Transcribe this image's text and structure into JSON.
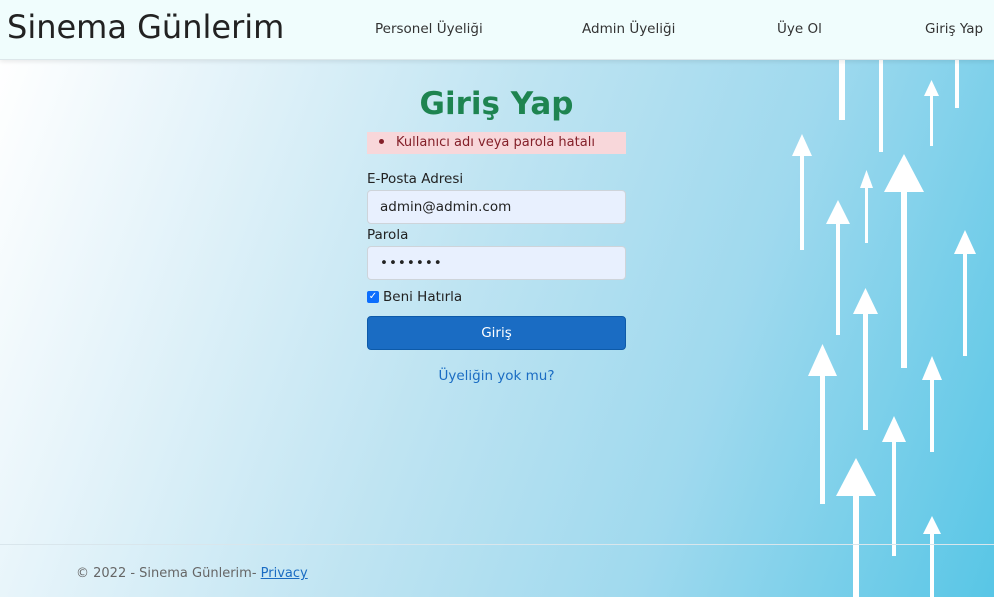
{
  "brand": "Sinema Günlerim",
  "nav": [
    {
      "label": "Personel Üyeliği"
    },
    {
      "label": "Admin Üyeliği"
    },
    {
      "label": "Üye Ol"
    },
    {
      "label": "Giriş Yap"
    }
  ],
  "login": {
    "title": "Giriş Yap",
    "error": "Kullanıcı adı veya parola hatalı",
    "email_label": "E-Posta Adresi",
    "email_value": "admin@admin.com",
    "password_label": "Parola",
    "password_value": "•••••••",
    "remember_label": "Beni Hatırla",
    "remember_checked": true,
    "submit_label": "Giriş",
    "signup_link": "Üyeliğin yok mu?"
  },
  "footer": {
    "text": "© 2022 - Sinema Günlerim- ",
    "privacy_link": "Privacy"
  },
  "colors": {
    "title": "#1e8450",
    "button": "#1a6cc3",
    "alert_bg": "#f8d7da",
    "alert_text": "#842029"
  }
}
